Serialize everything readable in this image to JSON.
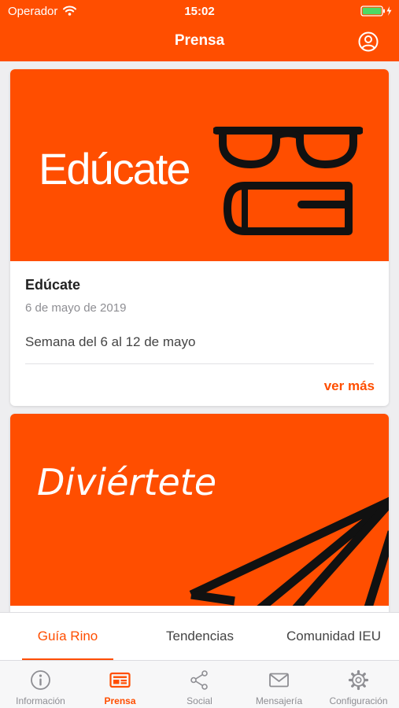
{
  "status_bar": {
    "carrier": "Operador",
    "time": "15:02"
  },
  "nav": {
    "title": "Prensa",
    "icon": "account-circle-icon"
  },
  "colors": {
    "accent": "#ff4e00",
    "background": "#eeeef0",
    "inactive": "#8e8e93"
  },
  "cards": [
    {
      "banner_text": "Edúcate",
      "banner_icon": "glasses-book-icon",
      "title": "Edúcate",
      "date": "6 de mayo de 2019",
      "description": "Semana del 6 al 12 de mayo",
      "action": "ver más"
    },
    {
      "banner_text": "Diviértete",
      "banner_icon": "paper-plane-icon"
    }
  ],
  "segments": [
    {
      "label": "Guía Rino",
      "active": true
    },
    {
      "label": "Tendencias",
      "active": false
    },
    {
      "label": "Comunidad IEU",
      "active": false
    }
  ],
  "tab_bar": [
    {
      "label": "Información",
      "icon": "info-icon",
      "active": false
    },
    {
      "label": "Prensa",
      "icon": "newspaper-icon",
      "active": true
    },
    {
      "label": "Social",
      "icon": "share-icon",
      "active": false
    },
    {
      "label": "Mensajería",
      "icon": "mail-icon",
      "active": false
    },
    {
      "label": "Configuración",
      "icon": "gear-icon",
      "active": false
    }
  ]
}
